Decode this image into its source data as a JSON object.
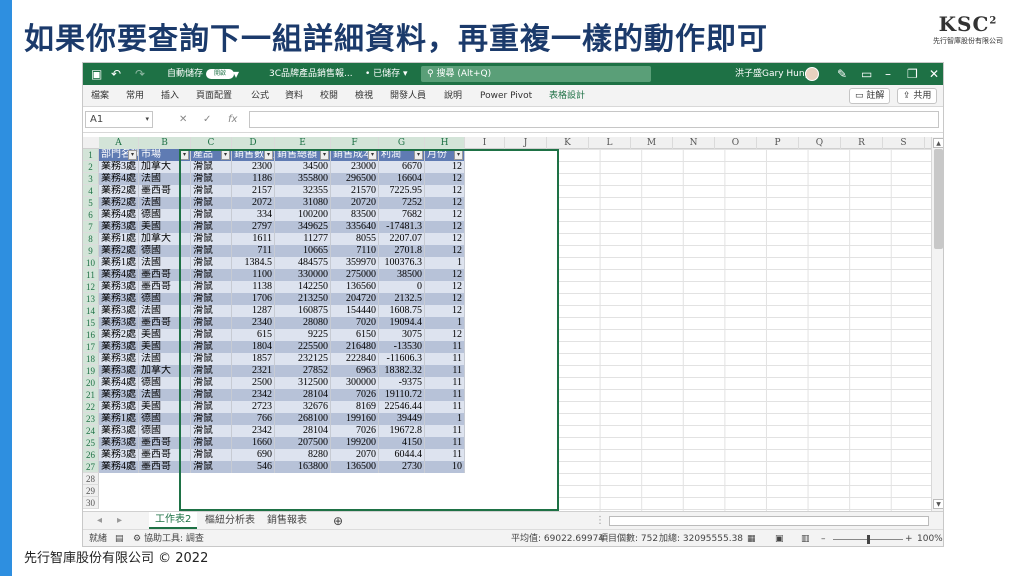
{
  "slide": {
    "title": "如果你要查詢下一組詳細資料，再重複一樣的動作即可",
    "logo_mark": "KSC",
    "logo_superscript": "2",
    "logo_sub": "先行智庫股份有限公司",
    "footer": "先行智庫股份有限公司 © 2022"
  },
  "excel": {
    "titlebar": {
      "autosave_label": "自動儲存",
      "autosave_state": "開啟",
      "filename": "3C品牌產品銷售報...",
      "saved_status": "• 已儲存 ▾",
      "search_placeholder": "搜尋 (Alt+Q)",
      "user_name": "洪子盛Gary Hung"
    },
    "ribbon": {
      "tabs": [
        "檔案",
        "常用",
        "插入",
        "頁面配置",
        "公式",
        "資料",
        "校閱",
        "檢視",
        "開發人員",
        "說明",
        "Power Pivot",
        "表格設計"
      ],
      "comments_label": "註解",
      "share_label": "共用"
    },
    "formula_bar": {
      "name_box": "A1",
      "cancel": "✕",
      "confirm": "✓",
      "fx": "fx",
      "value": ""
    },
    "columns": [
      "A",
      "B",
      "C",
      "D",
      "E",
      "F",
      "G",
      "H",
      "I",
      "J",
      "K",
      "L",
      "M",
      "N",
      "O",
      "P",
      "Q",
      "R",
      "S"
    ],
    "row_numbers": [
      "1",
      "2",
      "3",
      "4",
      "5",
      "6",
      "7",
      "8",
      "9",
      "10",
      "11",
      "12",
      "13",
      "14",
      "15",
      "16",
      "17",
      "18",
      "19",
      "20",
      "21",
      "22",
      "23",
      "24",
      "25",
      "26",
      "27",
      "28",
      "29",
      "30"
    ],
    "table_headers": [
      "部門名稱",
      "市場",
      "產品",
      "銷售數量",
      "銷售總額",
      "銷售成本",
      "利潤",
      "月份"
    ],
    "table_rows": [
      [
        "業務3處",
        "加拿大",
        "滑鼠",
        "2300",
        "34500",
        "23000",
        "6670",
        "12"
      ],
      [
        "業務4處",
        "法國",
        "滑鼠",
        "1186",
        "355800",
        "296500",
        "16604",
        "12"
      ],
      [
        "業務2處",
        "墨西哥",
        "滑鼠",
        "2157",
        "32355",
        "21570",
        "7225.95",
        "12"
      ],
      [
        "業務2處",
        "法國",
        "滑鼠",
        "2072",
        "31080",
        "20720",
        "7252",
        "12"
      ],
      [
        "業務4處",
        "德國",
        "滑鼠",
        "334",
        "100200",
        "83500",
        "7682",
        "12"
      ],
      [
        "業務3處",
        "美國",
        "滑鼠",
        "2797",
        "349625",
        "335640",
        "-17481.3",
        "12"
      ],
      [
        "業務1處",
        "加拿大",
        "滑鼠",
        "1611",
        "11277",
        "8055",
        "2207.07",
        "12"
      ],
      [
        "業務2處",
        "德國",
        "滑鼠",
        "711",
        "10665",
        "7110",
        "2701.8",
        "12"
      ],
      [
        "業務1處",
        "法國",
        "滑鼠",
        "1384.5",
        "484575",
        "359970",
        "100376.3",
        "1"
      ],
      [
        "業務4處",
        "墨西哥",
        "滑鼠",
        "1100",
        "330000",
        "275000",
        "38500",
        "12"
      ],
      [
        "業務3處",
        "墨西哥",
        "滑鼠",
        "1138",
        "142250",
        "136560",
        "0",
        "12"
      ],
      [
        "業務3處",
        "德國",
        "滑鼠",
        "1706",
        "213250",
        "204720",
        "2132.5",
        "12"
      ],
      [
        "業務3處",
        "法國",
        "滑鼠",
        "1287",
        "160875",
        "154440",
        "1608.75",
        "12"
      ],
      [
        "業務3處",
        "墨西哥",
        "滑鼠",
        "2340",
        "28080",
        "7020",
        "19094.4",
        "1"
      ],
      [
        "業務2處",
        "美國",
        "滑鼠",
        "615",
        "9225",
        "6150",
        "3075",
        "12"
      ],
      [
        "業務3處",
        "美國",
        "滑鼠",
        "1804",
        "225500",
        "216480",
        "-13530",
        "11"
      ],
      [
        "業務3處",
        "法國",
        "滑鼠",
        "1857",
        "232125",
        "222840",
        "-11606.3",
        "11"
      ],
      [
        "業務3處",
        "加拿大",
        "滑鼠",
        "2321",
        "27852",
        "6963",
        "18382.32",
        "11"
      ],
      [
        "業務4處",
        "德國",
        "滑鼠",
        "2500",
        "312500",
        "300000",
        "-9375",
        "11"
      ],
      [
        "業務3處",
        "法國",
        "滑鼠",
        "2342",
        "28104",
        "7026",
        "19110.72",
        "11"
      ],
      [
        "業務3處",
        "美國",
        "滑鼠",
        "2723",
        "32676",
        "8169",
        "22546.44",
        "11"
      ],
      [
        "業務1處",
        "德國",
        "滑鼠",
        "766",
        "268100",
        "199160",
        "39449",
        "1"
      ],
      [
        "業務3處",
        "德國",
        "滑鼠",
        "2342",
        "28104",
        "7026",
        "19672.8",
        "11"
      ],
      [
        "業務3處",
        "墨西哥",
        "滑鼠",
        "1660",
        "207500",
        "199200",
        "4150",
        "11"
      ],
      [
        "業務3處",
        "墨西哥",
        "滑鼠",
        "690",
        "8280",
        "2070",
        "6044.4",
        "11"
      ],
      [
        "業務4處",
        "墨西哥",
        "滑鼠",
        "546",
        "163800",
        "136500",
        "2730",
        "10"
      ]
    ],
    "sheet_tabs": [
      "工作表2",
      "樞紐分析表",
      "銷售報表"
    ],
    "status": {
      "ready": "就緒",
      "accessibility": "協助工具: 調查",
      "average": "平均值: 69022.69974",
      "count": "項目個數: 752",
      "sum": "加總: 32095555.38",
      "zoom": "100%"
    }
  }
}
